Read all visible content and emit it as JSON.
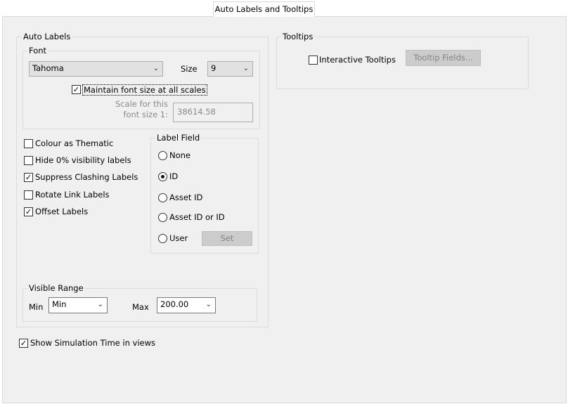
{
  "tab": {
    "label": "Auto Labels and Tooltips"
  },
  "auto_labels": {
    "title": "Auto Labels",
    "font": {
      "title": "Font",
      "font_value": "Tahoma",
      "size_label": "Size",
      "size_value": "9",
      "maintain_label": "Maintain font size at all scales",
      "maintain_checked": true,
      "scale_label_1": "Scale for this",
      "scale_label_2": "font size 1:",
      "scale_value": "38614.58"
    },
    "options": [
      {
        "label": "Colour as Thematic",
        "checked": false
      },
      {
        "label": "Hide 0% visibility labels",
        "checked": false
      },
      {
        "label": "Suppress Clashing Labels",
        "checked": true
      },
      {
        "label": "Rotate Link Labels",
        "checked": false
      },
      {
        "label": "Offset Labels",
        "checked": true
      }
    ],
    "label_field": {
      "title": "Label Field",
      "options": [
        {
          "label": "None",
          "selected": false
        },
        {
          "label": "ID",
          "selected": true
        },
        {
          "label": "Asset ID",
          "selected": false
        },
        {
          "label": "Asset ID or ID",
          "selected": false
        },
        {
          "label": "User",
          "selected": false
        }
      ],
      "set_label": "Set"
    },
    "visible_range": {
      "title": "Visible Range",
      "min_label": "Min",
      "min_value": "Min",
      "max_label": "Max",
      "max_value": "200.00"
    }
  },
  "show_sim_time": {
    "label": "Show Simulation Time in views",
    "checked": true
  },
  "tooltips": {
    "title": "Tooltips",
    "interactive_label": "Interactive Tooltips",
    "interactive_checked": false,
    "fields_button": "Tooltip Fields..."
  }
}
